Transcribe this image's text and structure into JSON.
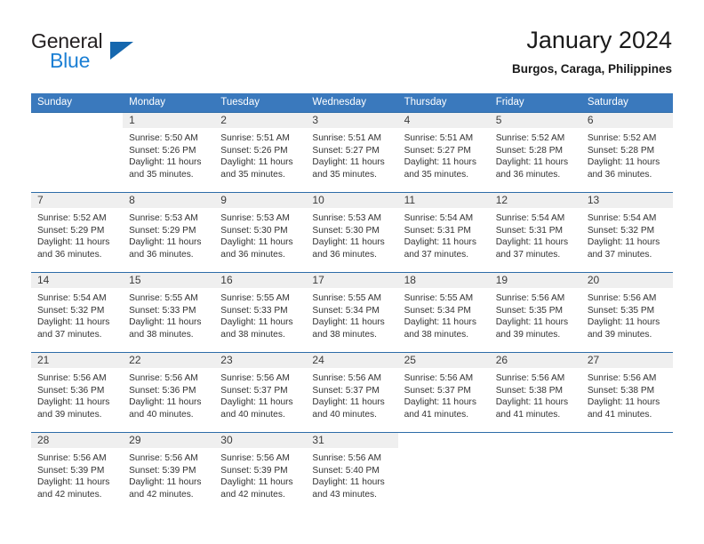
{
  "logo": {
    "word_top": "General",
    "word_bottom": "Blue",
    "triangle_color": "#1567ae",
    "blue_color": "#1b7fd4"
  },
  "header": {
    "title": "January 2024",
    "location": "Burgos, Caraga, Philippines"
  },
  "theme": {
    "header_row_bg": "#3a79bd",
    "row_divider": "#2d6ca8",
    "daynum_band_bg": "#efefef"
  },
  "weekday_headers": [
    "Sunday",
    "Monday",
    "Tuesday",
    "Wednesday",
    "Thursday",
    "Friday",
    "Saturday"
  ],
  "weeks": [
    [
      {
        "day": "",
        "sunrise": "",
        "sunset": "",
        "daylight_line1": "",
        "daylight_line2": ""
      },
      {
        "day": "1",
        "sunrise": "Sunrise: 5:50 AM",
        "sunset": "Sunset: 5:26 PM",
        "daylight_line1": "Daylight: 11 hours",
        "daylight_line2": "and 35 minutes."
      },
      {
        "day": "2",
        "sunrise": "Sunrise: 5:51 AM",
        "sunset": "Sunset: 5:26 PM",
        "daylight_line1": "Daylight: 11 hours",
        "daylight_line2": "and 35 minutes."
      },
      {
        "day": "3",
        "sunrise": "Sunrise: 5:51 AM",
        "sunset": "Sunset: 5:27 PM",
        "daylight_line1": "Daylight: 11 hours",
        "daylight_line2": "and 35 minutes."
      },
      {
        "day": "4",
        "sunrise": "Sunrise: 5:51 AM",
        "sunset": "Sunset: 5:27 PM",
        "daylight_line1": "Daylight: 11 hours",
        "daylight_line2": "and 35 minutes."
      },
      {
        "day": "5",
        "sunrise": "Sunrise: 5:52 AM",
        "sunset": "Sunset: 5:28 PM",
        "daylight_line1": "Daylight: 11 hours",
        "daylight_line2": "and 36 minutes."
      },
      {
        "day": "6",
        "sunrise": "Sunrise: 5:52 AM",
        "sunset": "Sunset: 5:28 PM",
        "daylight_line1": "Daylight: 11 hours",
        "daylight_line2": "and 36 minutes."
      }
    ],
    [
      {
        "day": "7",
        "sunrise": "Sunrise: 5:52 AM",
        "sunset": "Sunset: 5:29 PM",
        "daylight_line1": "Daylight: 11 hours",
        "daylight_line2": "and 36 minutes."
      },
      {
        "day": "8",
        "sunrise": "Sunrise: 5:53 AM",
        "sunset": "Sunset: 5:29 PM",
        "daylight_line1": "Daylight: 11 hours",
        "daylight_line2": "and 36 minutes."
      },
      {
        "day": "9",
        "sunrise": "Sunrise: 5:53 AM",
        "sunset": "Sunset: 5:30 PM",
        "daylight_line1": "Daylight: 11 hours",
        "daylight_line2": "and 36 minutes."
      },
      {
        "day": "10",
        "sunrise": "Sunrise: 5:53 AM",
        "sunset": "Sunset: 5:30 PM",
        "daylight_line1": "Daylight: 11 hours",
        "daylight_line2": "and 36 minutes."
      },
      {
        "day": "11",
        "sunrise": "Sunrise: 5:54 AM",
        "sunset": "Sunset: 5:31 PM",
        "daylight_line1": "Daylight: 11 hours",
        "daylight_line2": "and 37 minutes."
      },
      {
        "day": "12",
        "sunrise": "Sunrise: 5:54 AM",
        "sunset": "Sunset: 5:31 PM",
        "daylight_line1": "Daylight: 11 hours",
        "daylight_line2": "and 37 minutes."
      },
      {
        "day": "13",
        "sunrise": "Sunrise: 5:54 AM",
        "sunset": "Sunset: 5:32 PM",
        "daylight_line1": "Daylight: 11 hours",
        "daylight_line2": "and 37 minutes."
      }
    ],
    [
      {
        "day": "14",
        "sunrise": "Sunrise: 5:54 AM",
        "sunset": "Sunset: 5:32 PM",
        "daylight_line1": "Daylight: 11 hours",
        "daylight_line2": "and 37 minutes."
      },
      {
        "day": "15",
        "sunrise": "Sunrise: 5:55 AM",
        "sunset": "Sunset: 5:33 PM",
        "daylight_line1": "Daylight: 11 hours",
        "daylight_line2": "and 38 minutes."
      },
      {
        "day": "16",
        "sunrise": "Sunrise: 5:55 AM",
        "sunset": "Sunset: 5:33 PM",
        "daylight_line1": "Daylight: 11 hours",
        "daylight_line2": "and 38 minutes."
      },
      {
        "day": "17",
        "sunrise": "Sunrise: 5:55 AM",
        "sunset": "Sunset: 5:34 PM",
        "daylight_line1": "Daylight: 11 hours",
        "daylight_line2": "and 38 minutes."
      },
      {
        "day": "18",
        "sunrise": "Sunrise: 5:55 AM",
        "sunset": "Sunset: 5:34 PM",
        "daylight_line1": "Daylight: 11 hours",
        "daylight_line2": "and 38 minutes."
      },
      {
        "day": "19",
        "sunrise": "Sunrise: 5:56 AM",
        "sunset": "Sunset: 5:35 PM",
        "daylight_line1": "Daylight: 11 hours",
        "daylight_line2": "and 39 minutes."
      },
      {
        "day": "20",
        "sunrise": "Sunrise: 5:56 AM",
        "sunset": "Sunset: 5:35 PM",
        "daylight_line1": "Daylight: 11 hours",
        "daylight_line2": "and 39 minutes."
      }
    ],
    [
      {
        "day": "21",
        "sunrise": "Sunrise: 5:56 AM",
        "sunset": "Sunset: 5:36 PM",
        "daylight_line1": "Daylight: 11 hours",
        "daylight_line2": "and 39 minutes."
      },
      {
        "day": "22",
        "sunrise": "Sunrise: 5:56 AM",
        "sunset": "Sunset: 5:36 PM",
        "daylight_line1": "Daylight: 11 hours",
        "daylight_line2": "and 40 minutes."
      },
      {
        "day": "23",
        "sunrise": "Sunrise: 5:56 AM",
        "sunset": "Sunset: 5:37 PM",
        "daylight_line1": "Daylight: 11 hours",
        "daylight_line2": "and 40 minutes."
      },
      {
        "day": "24",
        "sunrise": "Sunrise: 5:56 AM",
        "sunset": "Sunset: 5:37 PM",
        "daylight_line1": "Daylight: 11 hours",
        "daylight_line2": "and 40 minutes."
      },
      {
        "day": "25",
        "sunrise": "Sunrise: 5:56 AM",
        "sunset": "Sunset: 5:37 PM",
        "daylight_line1": "Daylight: 11 hours",
        "daylight_line2": "and 41 minutes."
      },
      {
        "day": "26",
        "sunrise": "Sunrise: 5:56 AM",
        "sunset": "Sunset: 5:38 PM",
        "daylight_line1": "Daylight: 11 hours",
        "daylight_line2": "and 41 minutes."
      },
      {
        "day": "27",
        "sunrise": "Sunrise: 5:56 AM",
        "sunset": "Sunset: 5:38 PM",
        "daylight_line1": "Daylight: 11 hours",
        "daylight_line2": "and 41 minutes."
      }
    ],
    [
      {
        "day": "28",
        "sunrise": "Sunrise: 5:56 AM",
        "sunset": "Sunset: 5:39 PM",
        "daylight_line1": "Daylight: 11 hours",
        "daylight_line2": "and 42 minutes."
      },
      {
        "day": "29",
        "sunrise": "Sunrise: 5:56 AM",
        "sunset": "Sunset: 5:39 PM",
        "daylight_line1": "Daylight: 11 hours",
        "daylight_line2": "and 42 minutes."
      },
      {
        "day": "30",
        "sunrise": "Sunrise: 5:56 AM",
        "sunset": "Sunset: 5:39 PM",
        "daylight_line1": "Daylight: 11 hours",
        "daylight_line2": "and 42 minutes."
      },
      {
        "day": "31",
        "sunrise": "Sunrise: 5:56 AM",
        "sunset": "Sunset: 5:40 PM",
        "daylight_line1": "Daylight: 11 hours",
        "daylight_line2": "and 43 minutes."
      },
      {
        "day": "",
        "sunrise": "",
        "sunset": "",
        "daylight_line1": "",
        "daylight_line2": ""
      },
      {
        "day": "",
        "sunrise": "",
        "sunset": "",
        "daylight_line1": "",
        "daylight_line2": ""
      },
      {
        "day": "",
        "sunrise": "",
        "sunset": "",
        "daylight_line1": "",
        "daylight_line2": ""
      }
    ]
  ]
}
